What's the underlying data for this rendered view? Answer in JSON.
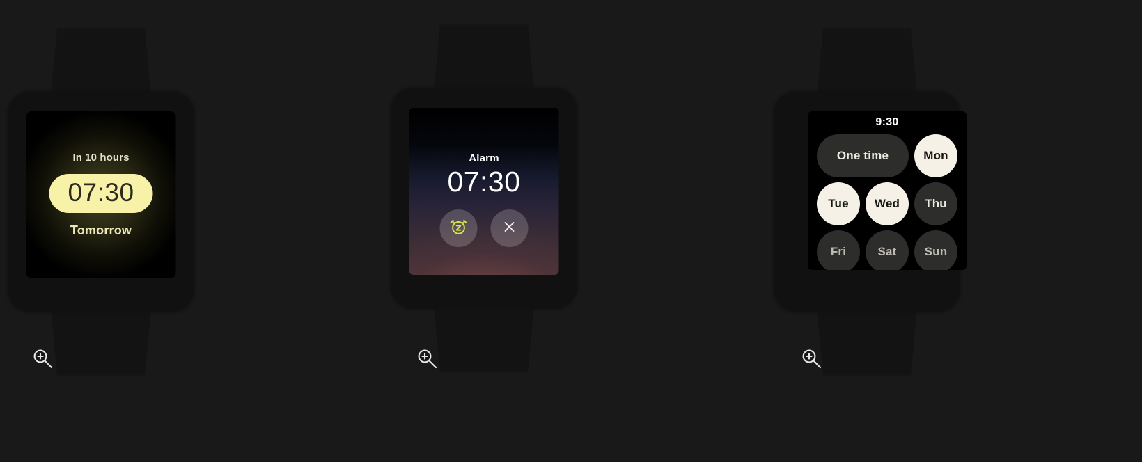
{
  "theme": {
    "page_background": "#191919",
    "watch_body": "#111111",
    "strap": "#131313",
    "accent_yellow": "#f7f2a8",
    "accent_snooze": "#d7e24f",
    "chip_on": "#f5f1e6",
    "chip_off": "#2d2d2b"
  },
  "watches": [
    {
      "name": "upcoming-alarm",
      "countdown": "In 10 hours",
      "time": "07:30",
      "day": "Tomorrow"
    },
    {
      "name": "alarm-ringing",
      "title": "Alarm",
      "time": "07:30",
      "actions": [
        {
          "name": "snooze-button",
          "icon": "alarm-snooze-icon",
          "label": "Snooze"
        },
        {
          "name": "dismiss-button",
          "icon": "close-icon",
          "label": "Dismiss"
        }
      ]
    },
    {
      "name": "repeat-day-picker",
      "clock": "9:30",
      "rows": [
        [
          {
            "label": "One time",
            "selected": false,
            "shape": "wide",
            "dim": false
          },
          {
            "label": "Mon",
            "selected": true,
            "shape": "round",
            "dim": false
          }
        ],
        [
          {
            "label": "Tue",
            "selected": true,
            "shape": "round",
            "dim": false
          },
          {
            "label": "Wed",
            "selected": true,
            "shape": "round",
            "dim": false
          },
          {
            "label": "Thu",
            "selected": false,
            "shape": "round",
            "dim": false
          }
        ],
        [
          {
            "label": "Fri",
            "selected": false,
            "shape": "round",
            "dim": true
          },
          {
            "label": "Sat",
            "selected": false,
            "shape": "round",
            "dim": true
          },
          {
            "label": "Sun",
            "selected": false,
            "shape": "round",
            "dim": true
          }
        ]
      ]
    }
  ],
  "magnifiers": [
    {
      "name": "zoom-in-icon-1",
      "icon": "magnifier-plus-icon"
    },
    {
      "name": "zoom-in-icon-2",
      "icon": "magnifier-plus-icon"
    },
    {
      "name": "zoom-in-icon-3",
      "icon": "magnifier-plus-icon"
    }
  ]
}
